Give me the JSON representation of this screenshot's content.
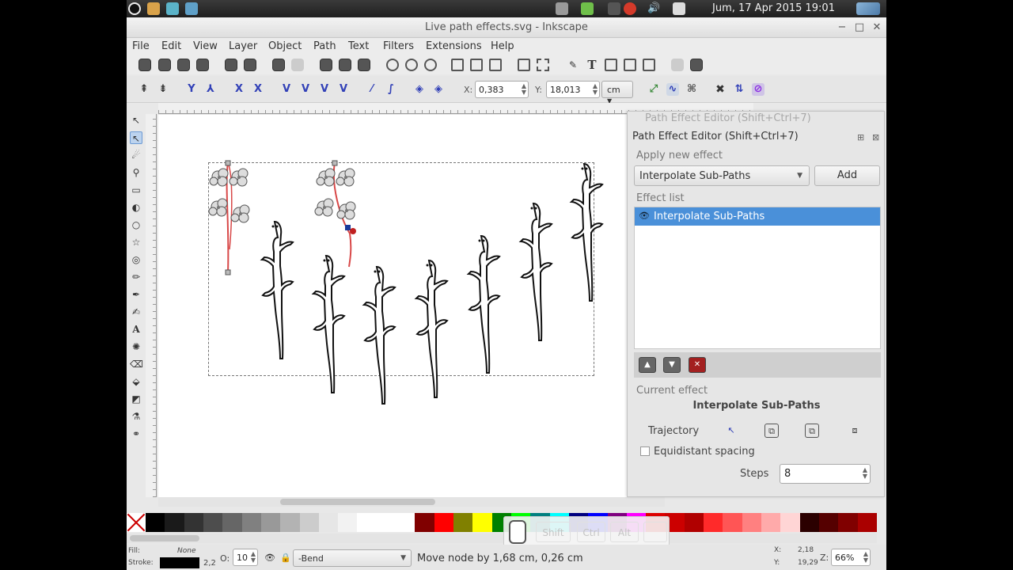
{
  "system": {
    "clock": "Jum, 17 Apr 2015 19:01"
  },
  "window": {
    "title": "Live path effects.svg - Inkscape"
  },
  "menu": [
    "File",
    "Edit",
    "View",
    "Layer",
    "Object",
    "Path",
    "Text",
    "Filters",
    "Extensions",
    "Help"
  ],
  "controls": {
    "x_label": "X:",
    "x_value": "0,383",
    "y_label": "Y:",
    "y_value": "18,013",
    "unit": "cm"
  },
  "dock": {
    "ghost_title": "Path Effect Editor (Shift+Ctrl+7)",
    "title": "Path Effect Editor (Shift+Ctrl+7)",
    "apply_label": "Apply new effect",
    "effect_select": "Interpolate Sub-Paths",
    "add_label": "Add",
    "list_label": "Effect list",
    "list_items": [
      "Interpolate Sub-Paths"
    ],
    "current_label": "Current effect",
    "current_name": "Interpolate Sub-Paths",
    "trajectory_label": "Trajectory",
    "equidistant_label": "Equidistant spacing",
    "steps_label": "Steps",
    "steps_value": "8"
  },
  "keys": [
    "Shift",
    "Ctrl",
    "Alt"
  ],
  "status": {
    "fill_label": "Fill:",
    "fill_value": "None",
    "stroke_label": "Stroke:",
    "stroke_width": "2,2",
    "opacity_label": "O:",
    "opacity_value": "10",
    "layer": "-Bend",
    "message": "Move node by 1,68 cm, 0,26 cm",
    "x_label": "X:",
    "x": "2,18",
    "y_label": "Y:",
    "y": "19,29",
    "z_label": "Z:",
    "zoom": "66%"
  },
  "palette": [
    "#000000",
    "#1a1a1a",
    "#333333",
    "#4d4d4d",
    "#666666",
    "#808080",
    "#999999",
    "#b3b3b3",
    "#cccccc",
    "#e6e6e6",
    "#f2f2f2",
    "#ffffff",
    "#ffffff",
    "#ffffff",
    "#800000",
    "#ff0000",
    "#808000",
    "#ffff00",
    "#008000",
    "#00ff00",
    "#008080",
    "#00ffff",
    "#000080",
    "#0000ff",
    "#800080",
    "#ff00ff",
    "#dd0000",
    "#cc0000",
    "#b00000",
    "#ff2a2a",
    "#ff5555",
    "#ff8080",
    "#ffaaaa",
    "#ffd5d5",
    "#2b0000",
    "#550000",
    "#800000",
    "#aa0000"
  ]
}
